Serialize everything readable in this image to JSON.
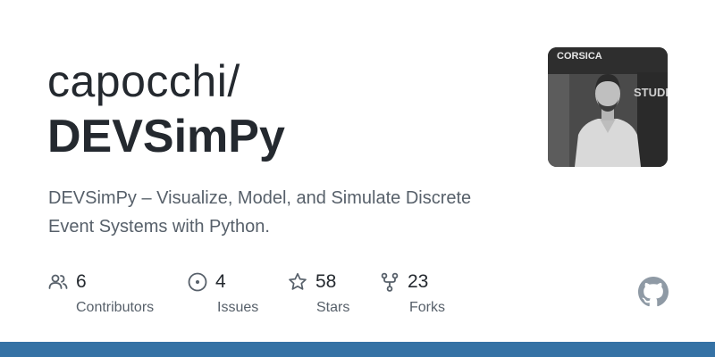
{
  "repo": {
    "owner": "capocchi/",
    "name": "DEVSimPy",
    "description": "DEVSimPy – Visualize, Model, and Simulate Discrete Event Systems with Python."
  },
  "stats": [
    {
      "icon": "people-icon",
      "value": "6",
      "label": "Contributors"
    },
    {
      "icon": "issue-icon",
      "value": "4",
      "label": "Issues"
    },
    {
      "icon": "star-icon",
      "value": "58",
      "label": "Stars"
    },
    {
      "icon": "fork-icon",
      "value": "23",
      "label": "Forks"
    }
  ],
  "avatar": {
    "banner_text": "CORSICA",
    "side_text": "STUDIA BER"
  },
  "colors": {
    "text_primary": "#24292f",
    "text_secondary": "#57606a",
    "language_bar": "#3572a5",
    "icon": "#57606a"
  },
  "brand_icon": "github-mark-icon"
}
